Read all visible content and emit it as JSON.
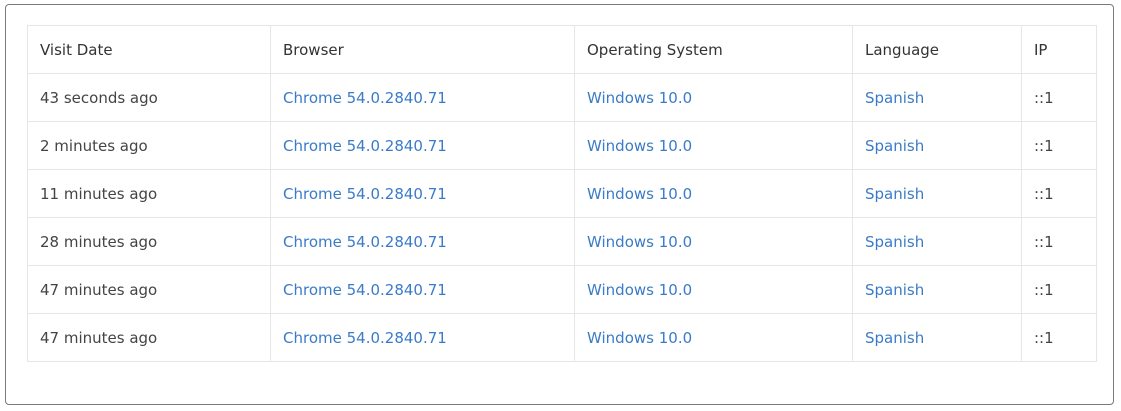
{
  "table": {
    "headers": [
      "Visit Date",
      "Browser",
      "Operating System",
      "Language",
      "IP"
    ],
    "rows": [
      {
        "visit_date": "43 seconds ago",
        "browser": "Chrome 54.0.2840.71",
        "os": "Windows 10.0",
        "language": "Spanish",
        "ip": "::1"
      },
      {
        "visit_date": "2 minutes ago",
        "browser": "Chrome 54.0.2840.71",
        "os": "Windows 10.0",
        "language": "Spanish",
        "ip": "::1"
      },
      {
        "visit_date": "11 minutes ago",
        "browser": "Chrome 54.0.2840.71",
        "os": "Windows 10.0",
        "language": "Spanish",
        "ip": "::1"
      },
      {
        "visit_date": "28 minutes ago",
        "browser": "Chrome 54.0.2840.71",
        "os": "Windows 10.0",
        "language": "Spanish",
        "ip": "::1"
      },
      {
        "visit_date": "47 minutes ago",
        "browser": "Chrome 54.0.2840.71",
        "os": "Windows 10.0",
        "language": "Spanish",
        "ip": "::1"
      },
      {
        "visit_date": "47 minutes ago",
        "browser": "Chrome 54.0.2840.71",
        "os": "Windows 10.0",
        "language": "Spanish",
        "ip": "::1"
      }
    ]
  },
  "colors": {
    "link": "#3a7bc8",
    "border": "#e6e6e6",
    "panel_border": "#7a7a7a",
    "text": "#333333"
  }
}
